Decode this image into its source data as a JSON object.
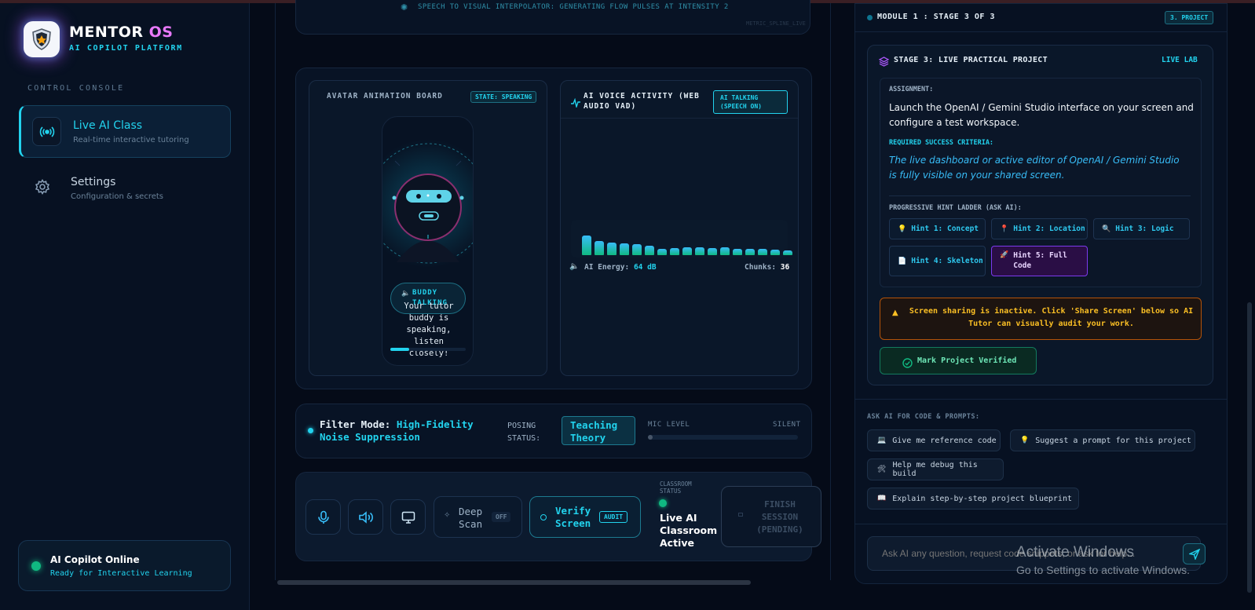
{
  "app": {
    "name_main": "MENTOR ",
    "name_accent": "OS",
    "subtitle": "AI COPILOT PLATFORM"
  },
  "sidebar": {
    "section_label": "CONTROL CONSOLE",
    "items": [
      {
        "label": "Live AI Class",
        "sub": "Real-time interactive tutoring",
        "icon": "broadcast-icon"
      },
      {
        "label": "Settings",
        "sub": "Configuration & secrets",
        "icon": "gear-icon"
      }
    ],
    "status": {
      "title": "AI Copilot Online",
      "sub": "Ready for Interactive Learning"
    }
  },
  "interpolator": {
    "text": "SPEECH TO VISUAL INTERPOLATOR: GENERATING FLOW PULSES AT INTENSITY 2",
    "small": "METRIC_SPLINE_LIVE"
  },
  "avatar_board": {
    "title": "AVATAR ANIMATION BOARD",
    "state": "STATE: SPEAKING",
    "bubble_label": "BUDDY TALKING",
    "speech": "Your tutor buddy is speaking, listen closely!",
    "progress": 0.25
  },
  "voice": {
    "title": "AI VOICE ACTIVITY (WEB AUDIO VAD)",
    "badge": "AI TALKING (SPEECH ON)",
    "energy_label": "AI Energy:",
    "energy_value": "64 dB",
    "chunks_label": "Chunks:",
    "chunks_value": "36",
    "levels": [
      0.62,
      0.45,
      0.4,
      0.38,
      0.36,
      0.3,
      0.2,
      0.22,
      0.25,
      0.26,
      0.22,
      0.24,
      0.2,
      0.2,
      0.2,
      0.18,
      0.16
    ]
  },
  "filter": {
    "label": "Filter Mode:",
    "mode": "High-Fidelity Noise Suppression",
    "posing_label": "POSING STATUS:",
    "posing_value": "Teaching Theory",
    "mic_label": "MIC LEVEL",
    "mic_state": "SILENT",
    "mic_level": 0.02
  },
  "controls": {
    "deep_scan": "Deep Scan",
    "deep_scan_state": "OFF",
    "verify": "Verify Screen",
    "verify_badge": "AUDIT",
    "classroom_label": "CLASSROOM STATUS",
    "classroom_value": "Live AI Classroom Active",
    "finish": "FINISH SESSION (PENDING)"
  },
  "module": {
    "title": "MODULE 1 : STAGE 3 OF 3",
    "badge": "3. PROJECT"
  },
  "stage": {
    "title": "STAGE 3: LIVE PRACTICAL PROJECT",
    "tag": "LIVE LAB",
    "assignment_label": "ASSIGNMENT:",
    "assignment": "Launch the OpenAI / Gemini Studio interface on your screen and configure a test workspace.",
    "criteria_label": "REQUIRED SUCCESS CRITERIA:",
    "criteria": "The live dashboard or active editor of OpenAI / Gemini Studio is fully visible on your shared screen.",
    "ladder_label": "PROGRESSIVE HINT LADDER (ASK AI):",
    "hints": [
      {
        "icon": "💡",
        "label": "Hint 1: Concept"
      },
      {
        "icon": "📍",
        "label": "Hint 2: Location"
      },
      {
        "icon": "🔍",
        "label": "Hint 3: Logic"
      },
      {
        "icon": "📄",
        "label": "Hint 4: Skeleton"
      },
      {
        "icon": "🚀",
        "label": "Hint 5: Full Code"
      }
    ],
    "warning": "Screen sharing is inactive. Click 'Share Screen' below so AI Tutor can visually audit your work.",
    "verify_button": "Mark Project Verified"
  },
  "ask": {
    "label": "ASK AI FOR CODE & PROMPTS:",
    "chips": [
      {
        "icon": "💻",
        "label": "Give me reference code"
      },
      {
        "icon": "💡",
        "label": "Suggest a prompt for this project"
      },
      {
        "icon": "🛠",
        "label": "Help me debug this build"
      },
      {
        "icon": "📖",
        "label": "Explain step-by-step project blueprint"
      }
    ],
    "placeholder": "Ask AI any question, request code snippets, or ask for help..."
  },
  "watermark": {
    "title": "Activate Windows",
    "sub": "Go to Settings to activate Windows."
  },
  "colors": {
    "accent": "#22d3ee",
    "success": "#10b981",
    "warning": "#fbbf24",
    "purple": "#a855f7"
  }
}
